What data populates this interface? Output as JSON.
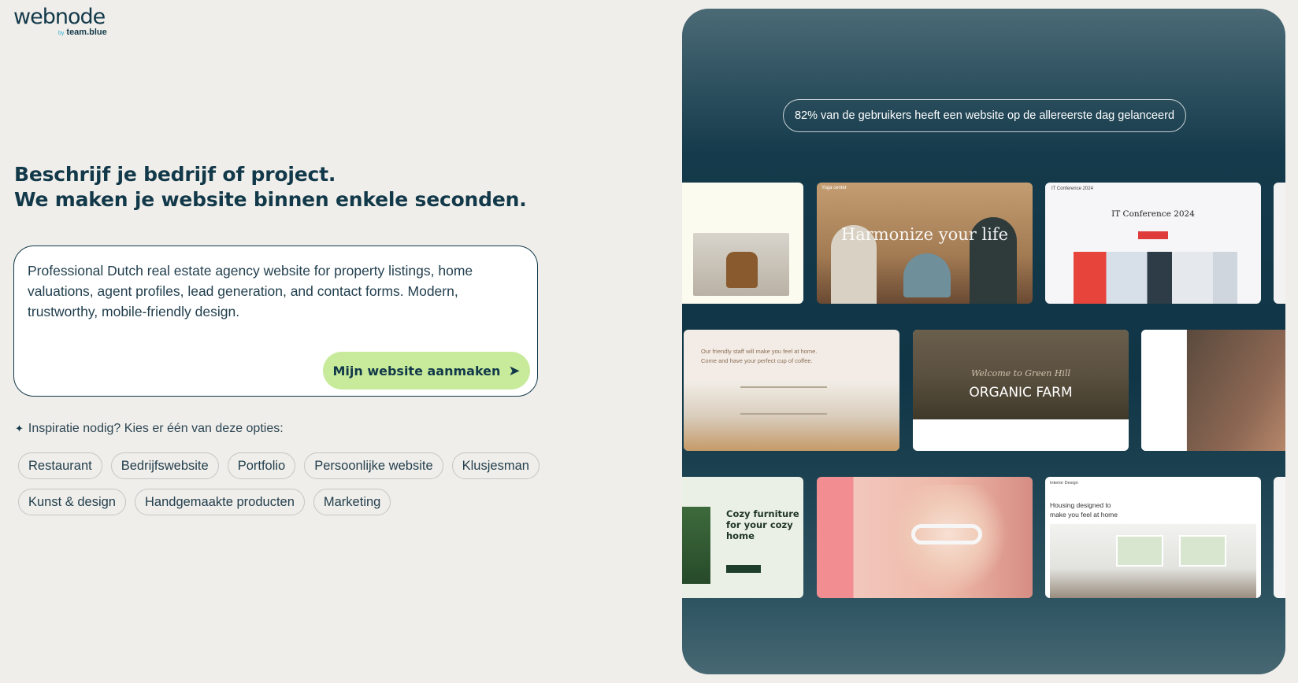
{
  "brand": {
    "name": "webnode",
    "by_prefix": "by",
    "by_name": "team.blue"
  },
  "headline": {
    "line1": "Beschrijf je bedrijf of project.",
    "line2": "We maken je website binnen enkele seconden."
  },
  "prompt": {
    "value": "Professional Dutch real estate agency website for property listings, home valuations, agent profiles, lead generation, and contact forms. Modern, trustworthy, mobile-friendly design.",
    "button_label": "Mijn website aanmaken",
    "button_icon": "arrow-right-icon"
  },
  "inspiration": {
    "label": "Inspiratie nodig? Kies er één van deze opties:",
    "icon": "sparkle-icon",
    "chips_row1": [
      "Restaurant",
      "Bedrijfswebsite",
      "Portfolio",
      "Persoonlijke website",
      "Klusjesman"
    ],
    "chips_row2": [
      "Kunst & design",
      "Handgemaakte producten",
      "Marketing"
    ]
  },
  "showcase": {
    "stat": "82% van de gebruikers heeft een website op de allereerste dag gelanceerd",
    "templates": {
      "yoga_title": "Harmonize your life",
      "yoga_nav": "Yoga center",
      "conference_nav": "IT Conference 2024",
      "conference_title": "IT Conference 2024",
      "cafe_text_1": "Our friendly staff will make you feel at home.",
      "cafe_text_2": "Come and have your perfect cup of coffee.",
      "farm_title": "ORGANIC FARM",
      "farm_subtitle": "Welcome to Green Hill",
      "furniture_line1": "Cozy furniture",
      "furniture_line2": "for your cozy",
      "furniture_line3": "home",
      "interior_nav": "Interior Design",
      "interior_line1": "Housing designed to",
      "interior_line2": "make you feel at home"
    }
  },
  "colors": {
    "page_bg": "#f0eeea",
    "brand_dark": "#12394a",
    "button_green": "#c8eb9b",
    "showcase_dark": "#0f3546"
  }
}
